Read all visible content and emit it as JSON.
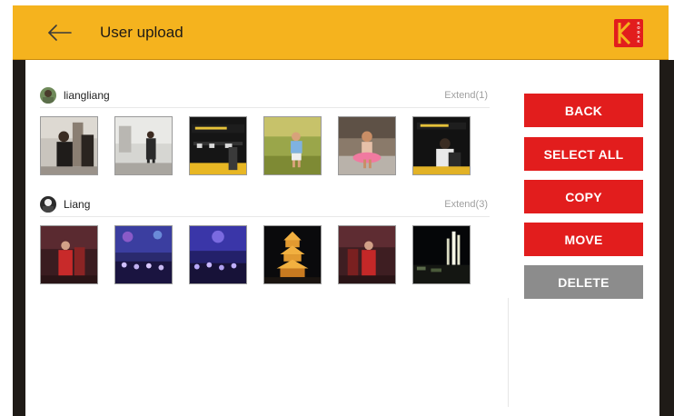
{
  "header": {
    "title": "User upload",
    "back_icon": "back-arrow-icon",
    "logo_text": "KODAK",
    "brand_color": "#f5b31e",
    "logo_color": "#e21d1d"
  },
  "groups": [
    {
      "username": "liangliang",
      "extend_label": "Extend(1)",
      "thumbnails": [
        "photo-street-portrait",
        "photo-woman-walking",
        "photo-exhibition-booth",
        "photo-child-in-field",
        "photo-girl-by-pool",
        "photo-booth-visitor"
      ]
    },
    {
      "username": "Liang",
      "extend_label": "Extend(3)",
      "thumbnails": [
        "photo-night-performer",
        "photo-concert-crowd",
        "photo-concert-stage",
        "photo-lit-pagoda",
        "photo-night-performer-2",
        "photo-city-night"
      ]
    }
  ],
  "actions": {
    "back": "BACK",
    "select_all": "SELECT ALL",
    "copy": "COPY",
    "move": "MOVE",
    "delete": "DELETE"
  },
  "colors": {
    "primary_button": "#e21d1d",
    "disabled_button": "#8c8c8c",
    "extend_text": "#a0a0a0"
  }
}
